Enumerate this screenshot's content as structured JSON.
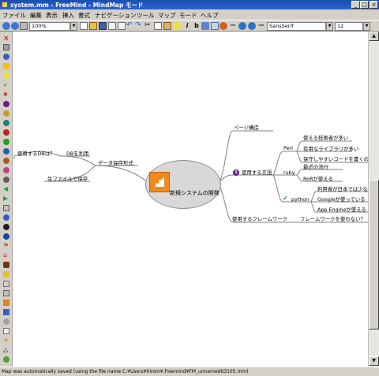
{
  "window": {
    "title": "system.mm - FreeMind - MindMap モード"
  },
  "menu": [
    "ファイル",
    "編集",
    "表示",
    "挿入",
    "書式",
    "ナビゲーション",
    "ツール",
    "マップ",
    "モード",
    "ヘルプ"
  ],
  "toolbar": {
    "zoom": "100%",
    "font_family": "SansSerif",
    "font_size": "12"
  },
  "mindmap": {
    "root": "新規システムの開発",
    "left": {
      "data_storage": "データ保存形式",
      "use_db": "DBを利用",
      "which_db": "使用するDBは？",
      "raw_file": "生ファイルで保存"
    },
    "right": {
      "page_structure": "ページ構造",
      "language": "使用する言語",
      "language_icon_label": "1",
      "perl": "Perl",
      "perl_1": "使える技術者が多い",
      "perl_2": "有用なライブラリが多い",
      "perl_3": "保守しやすいコードを書くのは",
      "ruby": "ruby",
      "ruby_1": "最近の流行",
      "ruby_2": "RoRが使える",
      "python": "python",
      "python_1": "利用者が日本では少な",
      "python_2": "Googleが使っている",
      "python_3": "App Engineが使える",
      "framework": "使用するフレームワーク",
      "framework_q": "フレームワークを使わない？"
    }
  },
  "status": "Map was automatically saved (using the file name C:¥Users¥hirom¥.freemind¥FM_unnamed63105.mm)",
  "colors": {
    "title_bar": "#2a5fc6",
    "edge": "#808080",
    "root_fill": "#d8d8d8",
    "root_icon": "#f08a1c",
    "priority_icon": "#6b1a8c",
    "check_icon": "#2ea02e"
  }
}
